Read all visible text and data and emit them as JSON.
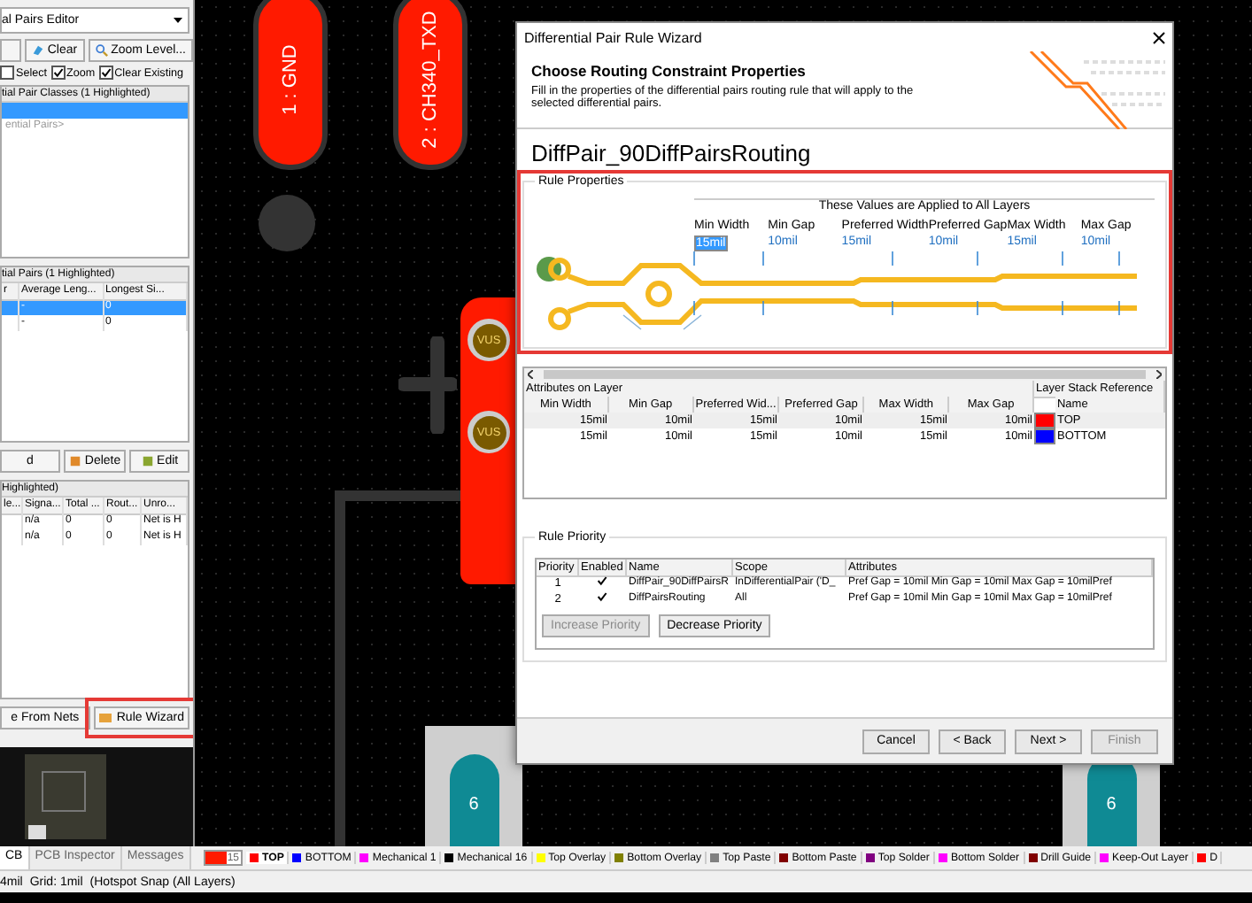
{
  "left_panel": {
    "title": "al Pairs Editor",
    "toolbar": [
      "Clear",
      "Zoom Level..."
    ],
    "options": [
      {
        "label": "Select",
        "checked": false
      },
      {
        "label": "Zoom",
        "checked": true
      },
      {
        "label": "Clear Existing",
        "checked": true
      }
    ],
    "classes": {
      "header": "tial Pair Classes (1 Highlighted)",
      "rows": [
        {
          "selected": true
        },
        {
          "label": "ential Pairs>",
          "selected": false
        }
      ]
    },
    "pairs": {
      "header": "tial Pairs (1 Highlighted)",
      "columns": [
        "r",
        "Average Leng...",
        "Longest Si..."
      ],
      "rows": [
        {
          "cells": [
            "",
            "-",
            "0"
          ],
          "selected": true
        },
        {
          "cells": [
            "",
            "-",
            "0"
          ],
          "selected": false
        }
      ]
    },
    "pair_buttons": [
      "d",
      "Delete",
      "Edit"
    ],
    "nets": {
      "header": "Highlighted)",
      "columns": [
        "le...",
        "Signa...",
        "Total ...",
        "Rout...",
        "Unro..."
      ],
      "rows": [
        {
          "cells": [
            "",
            "n/a",
            "0",
            "0",
            "Net is H"
          ]
        },
        {
          "cells": [
            "",
            "n/a",
            "0",
            "0",
            "Net is H"
          ]
        }
      ]
    },
    "bottom_buttons": [
      {
        "label": "e From Nets",
        "highlighted": false
      },
      {
        "label": "Rule Wizard",
        "highlighted": true
      }
    ],
    "tabs": [
      {
        "label": "CB",
        "selected": true
      },
      {
        "label": "PCB Inspector",
        "selected": false
      },
      {
        "label": "Messages",
        "selected": false
      }
    ]
  },
  "canvas": {
    "pads": [
      "1 : GND",
      "2 : CH340_TXD"
    ],
    "vias": [
      "VUS",
      "VUS"
    ],
    "bottom_pads": [
      "6",
      "6"
    ]
  },
  "dialog": {
    "title": "Differential Pair Rule Wizard",
    "heading": "Choose Routing Constraint Properties",
    "description": "Fill in the properties of the differential pairs routing rule that will apply to the selected differential pairs.",
    "rule_name": "DiffPair_90DiffPairsRouting",
    "rule_properties": {
      "title": "Rule Properties",
      "highlighted": true,
      "caption": "These Values are Applied to All Layers",
      "fields": [
        {
          "label": "Min Width",
          "value": "15mil",
          "selected": true
        },
        {
          "label": "Min Gap",
          "value": "10mil",
          "selected": false
        },
        {
          "label": "Preferred Width",
          "value": "15mil",
          "selected": false
        },
        {
          "label": "Preferred Gap",
          "value": "10mil",
          "selected": false
        },
        {
          "label": "Max Width",
          "value": "15mil",
          "selected": false
        },
        {
          "label": "Max Gap",
          "value": "10mil",
          "selected": false
        }
      ]
    },
    "attributes": {
      "group": "Attributes on Layer",
      "reference": "Layer Stack Reference",
      "columns": [
        "Min Width",
        "Min Gap",
        "Preferred Wid...",
        "Preferred Gap",
        "Max Width",
        "Max Gap"
      ],
      "name_column": "Name",
      "rows": [
        {
          "cells": [
            "15mil",
            "10mil",
            "15mil",
            "10mil",
            "15mil",
            "10mil"
          ],
          "color": "#ff0000",
          "layer": "TOP",
          "selected": true
        },
        {
          "cells": [
            "15mil",
            "10mil",
            "15mil",
            "10mil",
            "15mil",
            "10mil"
          ],
          "color": "#0000ff",
          "layer": "BOTTOM",
          "selected": false
        }
      ]
    },
    "priority": {
      "title": "Rule Priority",
      "columns": [
        "Priority",
        "Enabled",
        "Name",
        "Scope",
        "Attributes"
      ],
      "rows": [
        {
          "priority": "1",
          "enabled": true,
          "name": "DiffPair_90DiffPairsR",
          "scope": "InDifferentialPair ('D_",
          "attributes": "Pref Gap = 10mil  Min Gap = 10mil  Max Gap = 10milPref"
        },
        {
          "priority": "2",
          "enabled": true,
          "name": "DiffPairsRouting",
          "scope": "All",
          "attributes": "Pref Gap = 10mil  Min Gap = 10mil  Max Gap = 10milPref"
        }
      ],
      "buttons": [
        {
          "label": "Increase Priority",
          "disabled": true
        },
        {
          "label": "Decrease Priority",
          "disabled": false
        }
      ]
    },
    "buttons": [
      {
        "label": "Cancel",
        "disabled": false
      },
      {
        "label": "< Back",
        "disabled": false
      },
      {
        "label": "Next >",
        "disabled": false
      },
      {
        "label": "Finish",
        "disabled": true
      }
    ]
  },
  "layer_bar": {
    "layer_set": "15",
    "layers": [
      {
        "name": "TOP",
        "color": "#ff0000",
        "selected": true
      },
      {
        "name": "BOTTOM",
        "color": "#0000ff",
        "selected": false
      },
      {
        "name": "Mechanical 1",
        "color": "#ff00ff",
        "selected": false
      },
      {
        "name": "Mechanical 16",
        "color": "#000000",
        "selected": false
      },
      {
        "name": "Top Overlay",
        "color": "#ffff00",
        "selected": false
      },
      {
        "name": "Bottom Overlay",
        "color": "#808000",
        "selected": false
      },
      {
        "name": "Top Paste",
        "color": "#808080",
        "selected": false
      },
      {
        "name": "Bottom Paste",
        "color": "#800000",
        "selected": false
      },
      {
        "name": "Top Solder",
        "color": "#800080",
        "selected": false
      },
      {
        "name": "Bottom Solder",
        "color": "#ff00ff",
        "selected": false
      },
      {
        "name": "Drill Guide",
        "color": "#800000",
        "selected": false
      },
      {
        "name": "Keep-Out Layer",
        "color": "#ff00ff",
        "selected": false
      },
      {
        "name": "D",
        "color": "#ff0000",
        "selected": false
      }
    ]
  },
  "status_bar": [
    "4mil",
    "Grid: 1mil",
    "(Hotspot Snap (All Layers)"
  ]
}
